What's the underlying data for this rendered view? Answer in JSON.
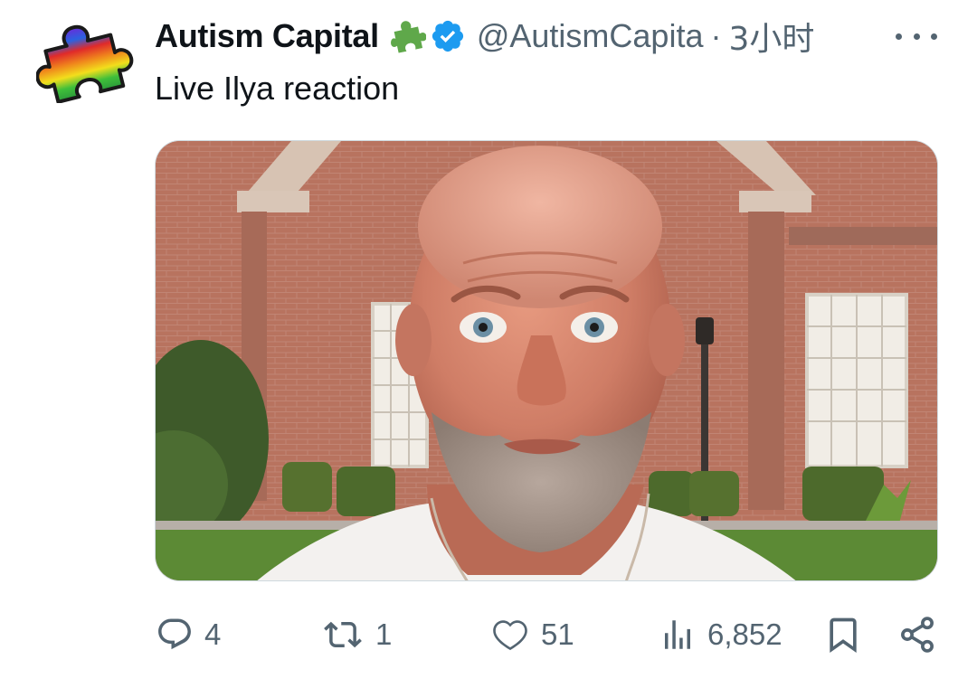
{
  "tweet": {
    "author": {
      "display_name": "Autism Capital",
      "handle": "@AutismCapita",
      "avatar_icon": "rainbow-puzzle-piece-icon",
      "badges": [
        "puzzle-piece-icon",
        "verified-badge-icon"
      ]
    },
    "separator": "·",
    "timestamp": "3小时",
    "text": "Live Ilya reaction",
    "media": {
      "type": "photo",
      "alt_subject": "close-up of a bald man with wide eyes in front of a brick house"
    },
    "actions": {
      "replies": {
        "icon": "reply-icon",
        "count": "4"
      },
      "retweets": {
        "icon": "retweet-icon",
        "count": "1"
      },
      "likes": {
        "icon": "heart-icon",
        "count": "51"
      },
      "views": {
        "icon": "views-bar-chart-icon",
        "count": "6,852"
      },
      "bookmark": {
        "icon": "bookmark-icon"
      },
      "share": {
        "icon": "share-icon"
      }
    },
    "more_icon": "more-options-icon"
  },
  "colors": {
    "text_primary": "#0f1419",
    "text_secondary": "#536471",
    "verified_blue": "#1d9bf0",
    "puzzle_green": "#5fa84a"
  }
}
